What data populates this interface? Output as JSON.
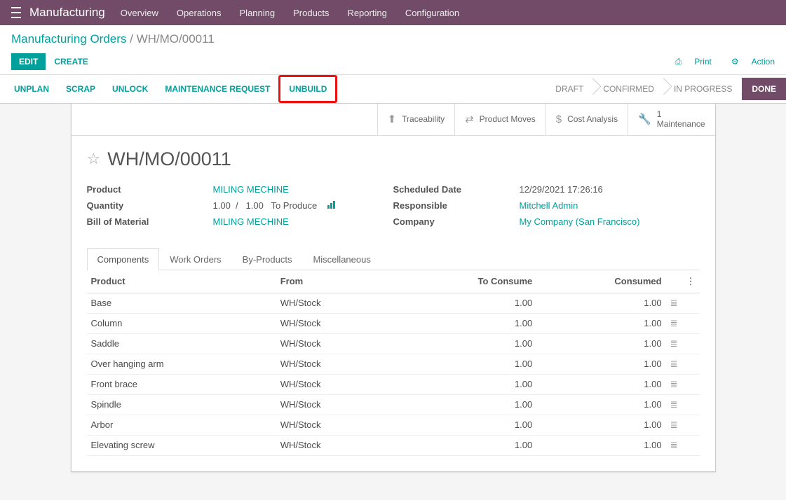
{
  "app_name": "Manufacturing",
  "nav": [
    "Overview",
    "Operations",
    "Planning",
    "Products",
    "Reporting",
    "Configuration"
  ],
  "breadcrumb": {
    "root": "Manufacturing Orders",
    "current": "WH/MO/00011"
  },
  "edit_label": "EDIT",
  "create_label": "CREATE",
  "print_label": "Print",
  "action_label": "Action",
  "action_buttons": [
    "UNPLAN",
    "SCRAP",
    "UNLOCK",
    "MAINTENANCE REQUEST",
    "UNBUILD"
  ],
  "highlighted_index": 4,
  "status_steps": [
    "DRAFT",
    "CONFIRMED",
    "IN PROGRESS",
    "DONE"
  ],
  "status_active": 3,
  "stat_buttons": [
    {
      "icon": "up",
      "label": "Traceability"
    },
    {
      "icon": "swap",
      "label": "Product Moves"
    },
    {
      "icon": "dollar",
      "label": "Cost Analysis"
    },
    {
      "icon": "wrench",
      "count": "1",
      "label": "Maintenance"
    }
  ],
  "mo_name": "WH/MO/00011",
  "fields_left": {
    "product_label": "Product",
    "product_value": "MILING MECHINE",
    "qty_label": "Quantity",
    "qty_value": "1.00",
    "qty_sep": "/",
    "qty_total": "1.00",
    "qty_suffix": "To Produce",
    "bom_label": "Bill of Material",
    "bom_value": "MILING MECHINE"
  },
  "fields_right": {
    "sched_label": "Scheduled Date",
    "sched_value": "12/29/2021 17:26:16",
    "resp_label": "Responsible",
    "resp_value": "Mitchell Admin",
    "comp_label": "Company",
    "comp_value": "My Company (San Francisco)"
  },
  "tabs": [
    "Components",
    "Work Orders",
    "By-Products",
    "Miscellaneous"
  ],
  "active_tab": 0,
  "table": {
    "cols": [
      "Product",
      "From",
      "To Consume",
      "Consumed"
    ],
    "rows": [
      {
        "product": "Base",
        "from": "WH/Stock",
        "to_consume": "1.00",
        "consumed": "1.00"
      },
      {
        "product": "Column",
        "from": "WH/Stock",
        "to_consume": "1.00",
        "consumed": "1.00"
      },
      {
        "product": "Saddle",
        "from": "WH/Stock",
        "to_consume": "1.00",
        "consumed": "1.00"
      },
      {
        "product": "Over hanging arm",
        "from": "WH/Stock",
        "to_consume": "1.00",
        "consumed": "1.00"
      },
      {
        "product": "Front brace",
        "from": "WH/Stock",
        "to_consume": "1.00",
        "consumed": "1.00"
      },
      {
        "product": "Spindle",
        "from": "WH/Stock",
        "to_consume": "1.00",
        "consumed": "1.00"
      },
      {
        "product": "Arbor",
        "from": "WH/Stock",
        "to_consume": "1.00",
        "consumed": "1.00"
      },
      {
        "product": "Elevating screw",
        "from": "WH/Stock",
        "to_consume": "1.00",
        "consumed": "1.00"
      }
    ]
  }
}
